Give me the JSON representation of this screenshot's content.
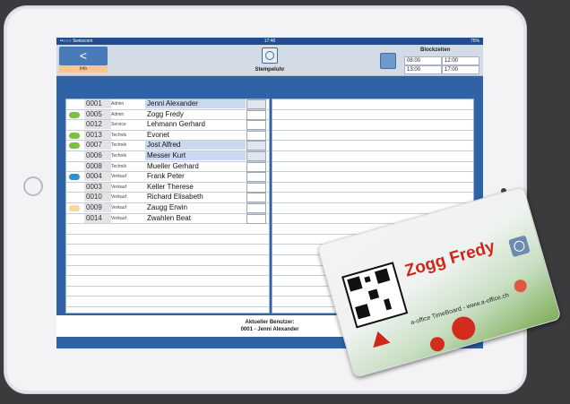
{
  "status_bar": {
    "carrier": "••○○○ Swisscom",
    "time": "17:46",
    "battery": "75%"
  },
  "toolbar": {
    "back_label": "<",
    "info_label": "Info",
    "clock_label": "Stempeluhr",
    "block_title": "Blockzeiten",
    "block_times": [
      "08:00",
      "12:00",
      "13:00",
      "17:00"
    ]
  },
  "employees": [
    {
      "num": "0001",
      "dept": "Admin",
      "name": "Jenni Alexander",
      "dot": "",
      "selected": true
    },
    {
      "num": "0005",
      "dept": "Admin",
      "name": "Zogg Fredy",
      "dot": "#7ac143",
      "selected": false
    },
    {
      "num": "0012",
      "dept": "Service",
      "name": "Lehmann Gerhard",
      "dot": "",
      "selected": false
    },
    {
      "num": "0013",
      "dept": "Technik",
      "name": "Evonet",
      "dot": "#7ac143",
      "selected": false
    },
    {
      "num": "0007",
      "dept": "Technik",
      "name": "Jost Alfred",
      "dot": "#7ac143",
      "selected": true
    },
    {
      "num": "0006",
      "dept": "Technik",
      "name": "Messer Kurt",
      "dot": "",
      "selected": true
    },
    {
      "num": "0008",
      "dept": "Technik",
      "name": "Mueller Gerhard",
      "dot": "",
      "selected": false
    },
    {
      "num": "0004",
      "dept": "Verkauf",
      "name": "Frank Peter",
      "dot": "#2f8fd0",
      "selected": false
    },
    {
      "num": "0003",
      "dept": "Verkauf",
      "name": "Keller Therese",
      "dot": "",
      "selected": false
    },
    {
      "num": "0010",
      "dept": "Verkauf",
      "name": "Richard Elisabeth",
      "dot": "",
      "selected": false
    },
    {
      "num": "0009",
      "dept": "Verkauf",
      "name": "Zaugg Erwin",
      "dot": "#f7d79a",
      "selected": false
    },
    {
      "num": "0014",
      "dept": "Verkauf",
      "name": "Zwahlen Beat",
      "dot": "",
      "selected": false
    }
  ],
  "footer": {
    "label": "Aktueller Benutzer:",
    "user": "0001 - Jenni Alexander"
  },
  "card": {
    "name": "Zogg Fredy",
    "brand": "a-office TimeBoard - www.a-office.ch"
  }
}
